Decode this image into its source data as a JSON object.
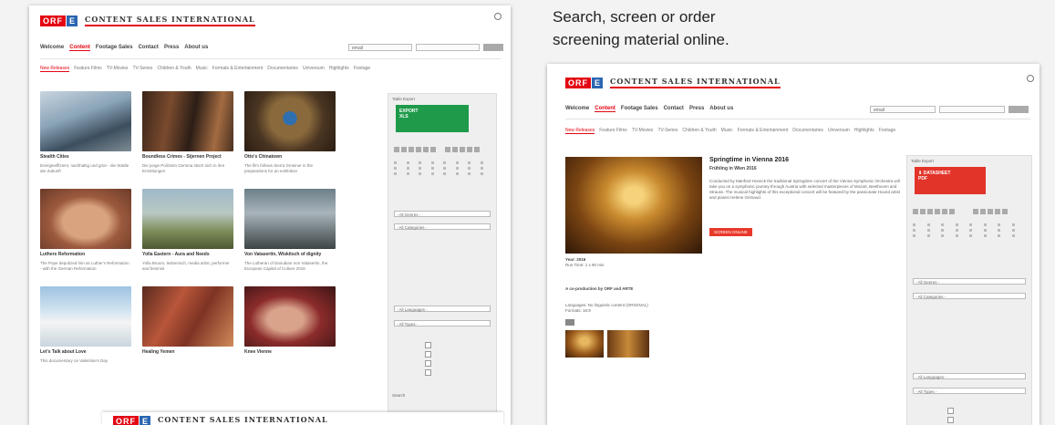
{
  "brand": {
    "orf": "ORF",
    "e": "E",
    "name": "CONTENT SALES INTERNATIONAL"
  },
  "caption": {
    "line1": "Search, screen or order",
    "line2": "screening material online."
  },
  "topnav": [
    "Welcome",
    "Content",
    "Footage Sales",
    "Contact",
    "Press",
    "About us"
  ],
  "catnav": [
    "New Releases",
    "Feature Films",
    "TV-Movies",
    "TV-Series",
    "Children & Youth",
    "Music",
    "Formats & Entertainment",
    "Documentaries",
    "Universum",
    "Highlights",
    "Footage"
  ],
  "search": {
    "placeholder": "email"
  },
  "cards": [
    {
      "title": "Stealth Cities",
      "desc": "Energieeffizient, nachhaltig und grün - die Städte der Zukunft"
    },
    {
      "title": "Boundless Crimes - Stjernen Project",
      "desc": "Die junge Polizistin Gemma stürzt sich in ihre Ermittlungen"
    },
    {
      "title": "Otto's Chinatown",
      "desc": "The film follows Sierra Gmeiner in the preparations for an exhibition"
    },
    {
      "title": "Luthers Reformation",
      "desc": "The Pope deputized him as Luther's Reformation - with the German Reformation"
    },
    {
      "title": "Yolla Eastern - Aura and Needs",
      "desc": "Yolla Bruum, lesbenisch, media artist, performer and feminist"
    },
    {
      "title": "Von Vatasertin, Wiskitsch of dignity",
      "desc": "The Lutheran of Danubian Von Vatasertin, the European Capital of Culture 2016"
    },
    {
      "title": "Let's Talk about Love",
      "desc": "This documentary on Valentine's Day"
    },
    {
      "title": "Healing Yemen",
      "desc": ""
    },
    {
      "title": "Knee Vienne",
      "desc": ""
    }
  ],
  "sidebar1": {
    "head": "Table Export",
    "export": "EXPORT",
    "export_sub": "XLS",
    "sel1": "- All Genres -",
    "sel2": "- All Categories -",
    "sel3": "- All Languages -",
    "sel4": "- All Types -",
    "search": "Search"
  },
  "detail": {
    "title": "Springtime in Vienna 2016",
    "subtitle": "Frühling in Wien 2016",
    "desc": "Conducted by Manfred Honeck the traditional Springtime concert of the Vienna Symphonic Orchestra will take you on a symphonic journey through Austria with selected masterpieces of Mozart, Beethoven and Strauss. The musical highlights of this exceptional concert will be featured by the passionate Hound artist and pianist Helene Grimaud.",
    "button": "SCREEN ONLINE",
    "year": "Year: 2016",
    "runtime": "Run Time: 1 x 90 min",
    "coprod": "A co-production by ORF and ARTE",
    "languages": "Languages: No linguistic content (ORIGINAL)",
    "format": "Formats: 16:9",
    "datasheet": "DATASHEET",
    "datasheet_sub": "PDF"
  },
  "colors": {
    "accent": "#e30613",
    "export_green": "#1e9a4a",
    "datasheet_red": "#e3342a"
  }
}
